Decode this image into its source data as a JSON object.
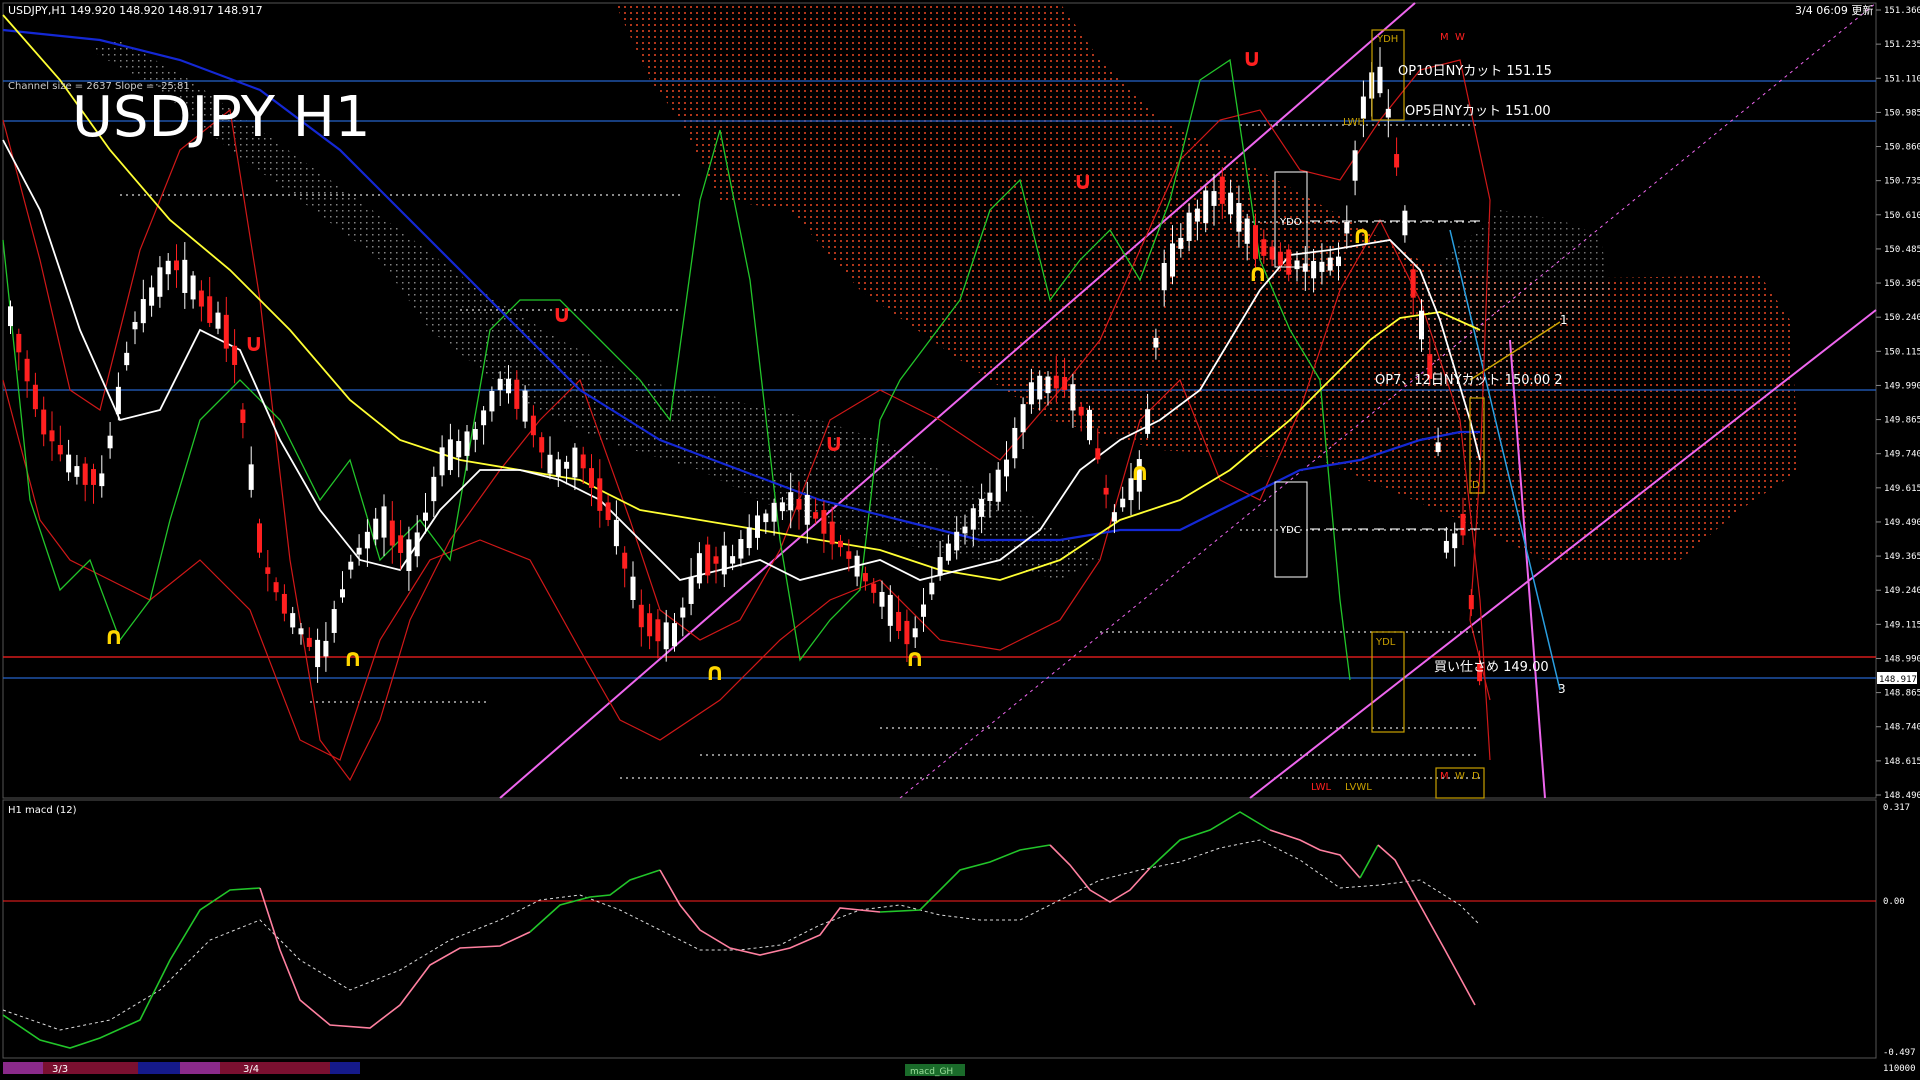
{
  "window": {
    "header_info": "USDJPY,H1  149.920 148.920 148.917 148.917",
    "timestamp": "3/4 06:09 更新",
    "channel_info": "Channel size = 2637 Slope = -25.81",
    "big_title": "USDJPY H1"
  },
  "price_axis": {
    "ticks": [
      "151.360",
      "151.235",
      "151.110",
      "150.985",
      "150.860",
      "150.735",
      "150.610",
      "150.485",
      "150.365",
      "150.240",
      "150.115",
      "149.990",
      "149.865",
      "149.740",
      "149.615",
      "149.490",
      "149.365",
      "149.240",
      "149.115",
      "148.990",
      "148.865",
      "148.740",
      "148.615",
      "148.490"
    ],
    "current_price": "148.917"
  },
  "macd_axis": {
    "top": "0.317",
    "zero": "0.00",
    "bottom": "-0.497",
    "foot": "110000"
  },
  "macd_panel": {
    "label": "H1  macd (12)"
  },
  "annotations": {
    "op10": "OP10日NYカット 151.15",
    "op5": "OP5日NYカット 151.00",
    "op7": "OP7、12日NYカット 150.00  2",
    "buy": "買い仕さめ 149.00",
    "ydh": "YDH",
    "ydl": "YDL",
    "ydo": "YDO",
    "ydc": "YDC",
    "lwl": "LWL",
    "lvwl": "LVWL",
    "lwh": "LWH",
    "m": "M",
    "w": "W",
    "d": "D",
    "line1": "1",
    "line3": "3"
  },
  "bottom_bar": {
    "date1": "3/3",
    "date2": "3/4",
    "tab": "macd_GH"
  },
  "colors": {
    "bg": "#000000",
    "grid_blue": "#1a5fb4",
    "red": "#ff2020",
    "white": "#ffffff",
    "yellow": "#ffff33",
    "green": "#22c52a",
    "magenta": "#ee66ee",
    "navy": "#1428d4",
    "gold": "#c8a000",
    "pink": "#ff80a0",
    "cyan": "#2a9fe0"
  }
}
